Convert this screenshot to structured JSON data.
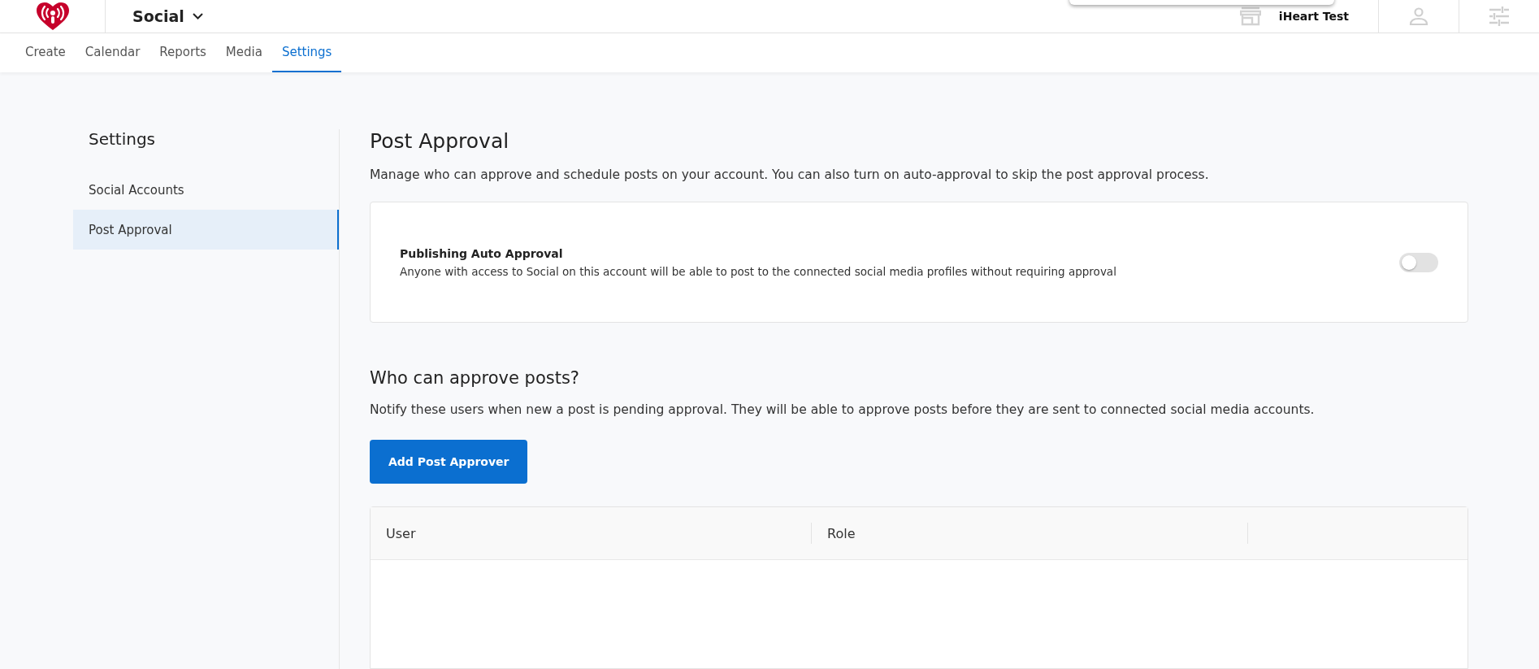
{
  "header": {
    "app_name": "Social",
    "account_name": "iHeart Test"
  },
  "tabs": [
    {
      "label": "Create",
      "selected": false
    },
    {
      "label": "Calendar",
      "selected": false
    },
    {
      "label": "Reports",
      "selected": false
    },
    {
      "label": "Media",
      "selected": false
    },
    {
      "label": "Settings",
      "selected": true
    }
  ],
  "sidebar": {
    "title": "Settings",
    "items": [
      {
        "label": "Social Accounts",
        "selected": false
      },
      {
        "label": "Post Approval",
        "selected": true
      }
    ]
  },
  "page": {
    "title": "Post Approval",
    "description": "Manage who can approve and schedule posts on your account. You can also turn on auto-approval to skip the post approval process.",
    "auto_approval": {
      "title": "Publishing Auto Approval",
      "description": "Anyone with access to Social on this account will be able to post to the connected social media profiles without requiring approval",
      "on": false
    },
    "approvers": {
      "title": "Who can approve posts?",
      "description": "Notify these users when new a post is pending approval. They will be able to approve posts before they are sent to connected social media accounts.",
      "button": "Add Post Approver"
    },
    "table": {
      "columns": [
        "User",
        "Role"
      ]
    }
  }
}
